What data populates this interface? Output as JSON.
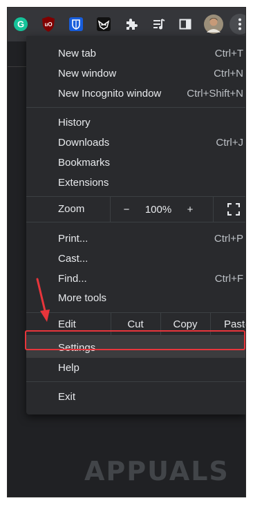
{
  "toolbar": {
    "icons": [
      "grammarly-icon",
      "ublock-icon",
      "bitwarden-icon",
      "extension-mask-icon",
      "extensions-puzzle-icon",
      "media-queue-icon",
      "side-panel-icon",
      "profile-avatar",
      "more-menu-icon"
    ],
    "grammarly_letter": "G",
    "ublock_text": "uO"
  },
  "menu": {
    "new_tab": {
      "label": "New tab",
      "shortcut": "Ctrl+T"
    },
    "new_window": {
      "label": "New window",
      "shortcut": "Ctrl+N"
    },
    "new_incognito": {
      "label": "New Incognito window",
      "shortcut": "Ctrl+Shift+N"
    },
    "history": {
      "label": "History"
    },
    "downloads": {
      "label": "Downloads",
      "shortcut": "Ctrl+J"
    },
    "bookmarks": {
      "label": "Bookmarks"
    },
    "extensions": {
      "label": "Extensions"
    },
    "zoom": {
      "label": "Zoom",
      "minus": "−",
      "value": "100%",
      "plus": "+"
    },
    "print": {
      "label": "Print...",
      "shortcut": "Ctrl+P"
    },
    "cast": {
      "label": "Cast..."
    },
    "find": {
      "label": "Find...",
      "shortcut": "Ctrl+F"
    },
    "more_tools": {
      "label": "More tools"
    },
    "edit": {
      "label": "Edit",
      "cut": "Cut",
      "copy": "Copy",
      "paste": "Paste"
    },
    "settings": {
      "label": "Settings"
    },
    "help": {
      "label": "Help"
    },
    "exit": {
      "label": "Exit"
    }
  },
  "annotation": {
    "highlight_color": "#e8353b"
  },
  "watermark": {
    "text": "APPUALS"
  }
}
